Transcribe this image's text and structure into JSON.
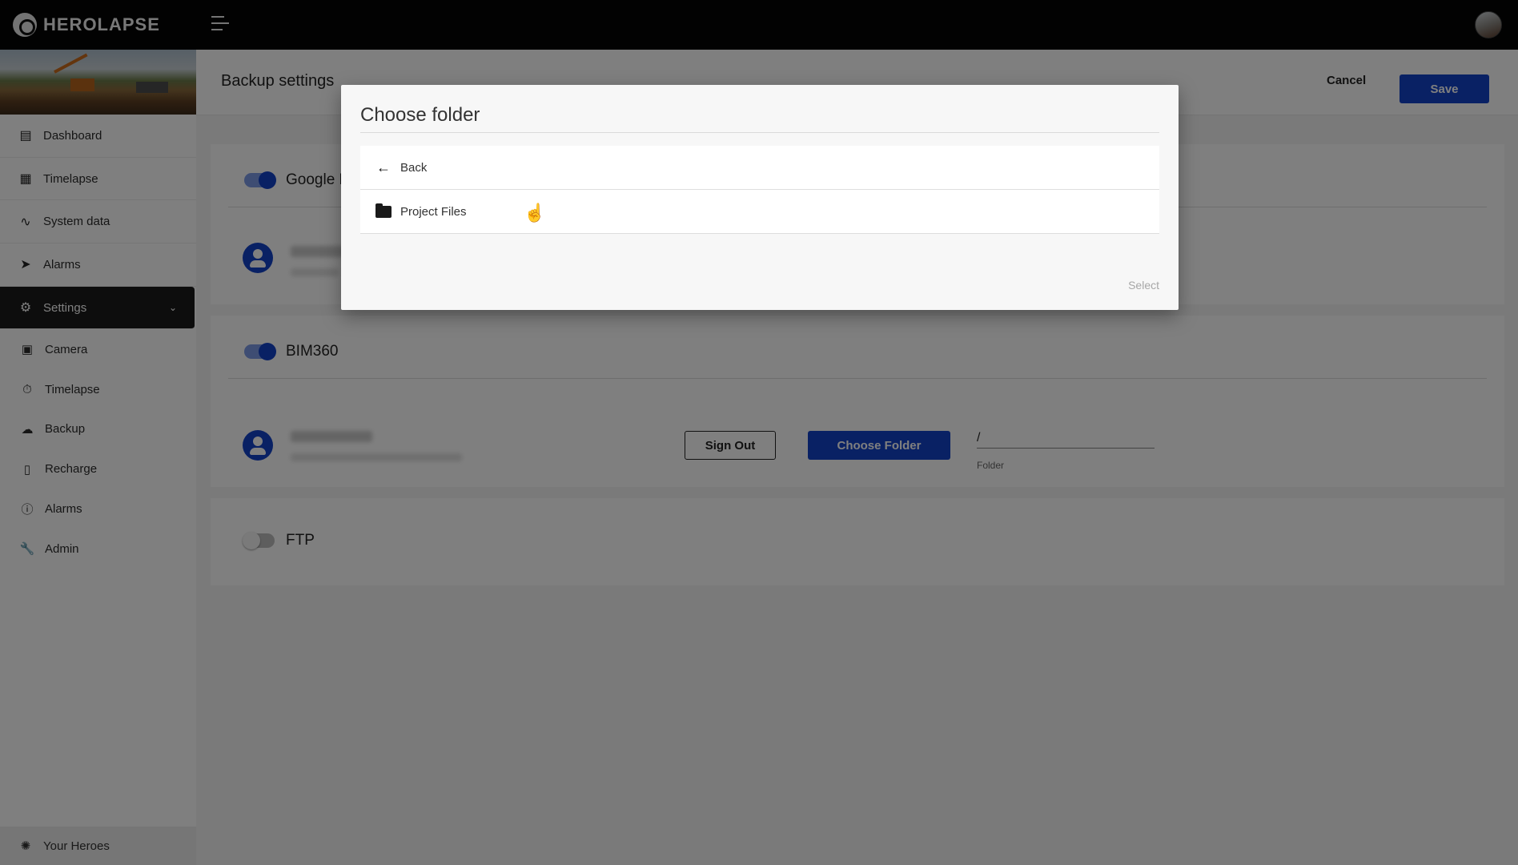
{
  "app": {
    "logo_text": "HEROLAPSE"
  },
  "sidebar": {
    "items": [
      {
        "label": "Dashboard",
        "icon": "chart-icon"
      },
      {
        "label": "Timelapse",
        "icon": "image-icon"
      },
      {
        "label": "System data",
        "icon": "analytics-icon"
      },
      {
        "label": "Alarms",
        "icon": "megaphone-icon"
      },
      {
        "label": "Settings",
        "icon": "gear-icon"
      }
    ],
    "settings_sub": [
      {
        "label": "Camera",
        "icon": "camera-icon"
      },
      {
        "label": "Timelapse",
        "icon": "timer-icon"
      },
      {
        "label": "Backup",
        "icon": "cloud-upload-icon"
      },
      {
        "label": "Recharge",
        "icon": "battery-icon"
      },
      {
        "label": "Alarms",
        "icon": "alert-circle-icon"
      },
      {
        "label": "Admin",
        "icon": "wrench-icon"
      }
    ],
    "footer": {
      "label": "Your Heroes",
      "icon": "logo-icon"
    }
  },
  "header": {
    "title": "Backup settings",
    "cancel": "Cancel",
    "save": "Save"
  },
  "sections": {
    "google": {
      "label": "Google D",
      "enabled": true
    },
    "bim360": {
      "label": "BIM360",
      "enabled": true,
      "sign_out": "Sign Out",
      "choose_folder": "Choose Folder",
      "folder_value": "/",
      "folder_label": "Folder"
    },
    "ftp": {
      "label": "FTP",
      "enabled": false
    }
  },
  "dialog": {
    "title": "Choose folder",
    "back": "Back",
    "items": [
      {
        "label": "Project Files",
        "icon": "folder-icon"
      }
    ],
    "select": "Select"
  },
  "colors": {
    "primary": "#1342c8",
    "topbar": "#050505",
    "active_nav": "#1a1a1a"
  }
}
